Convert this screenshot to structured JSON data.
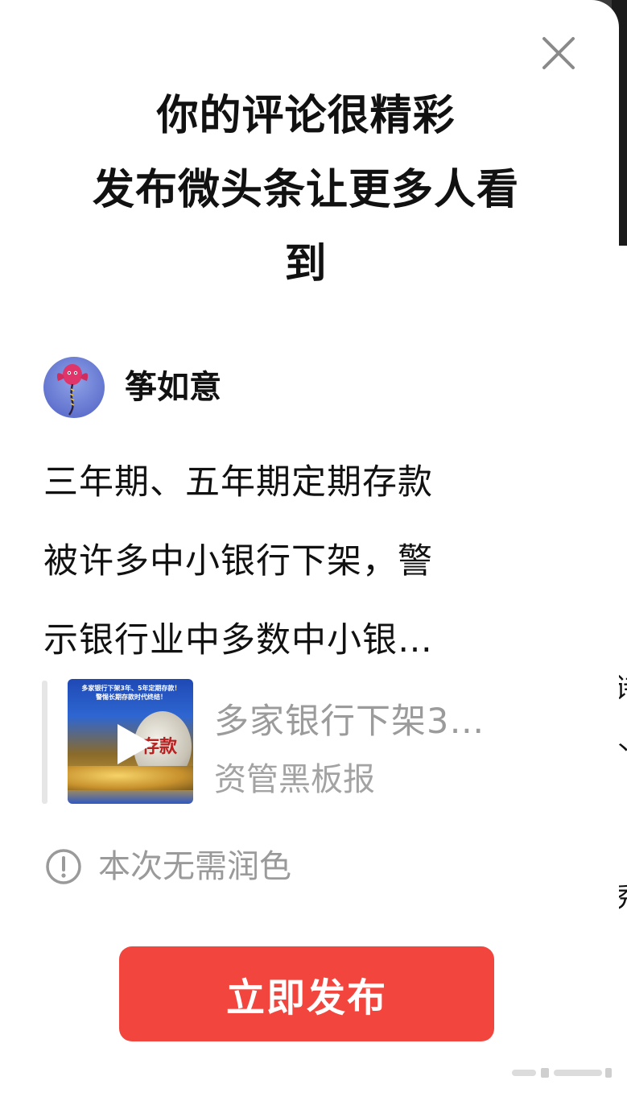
{
  "modal": {
    "title_lines": [
      "你的评论很精彩",
      "发布微头条让更多人看",
      "到"
    ]
  },
  "author": {
    "name": "筝如意",
    "avatar_icon": "kite-avatar-icon"
  },
  "comment": {
    "lines": [
      "三年期、五年期定期存款",
      "被许多中小银行下架，警",
      "示银行业中多数中小银…"
    ]
  },
  "article": {
    "title": "多家银行下架3…",
    "source": "资管黑板报",
    "thumbnail_caption": "多家银行下架3年、5年定期存款！\n警惕长期存款时代终结！",
    "thumbnail_coin_text": "存款"
  },
  "notice": {
    "text": "本次无需润色"
  },
  "actions": {
    "publish_label": "立即发布"
  },
  "background_glyphs": [
    "诗",
    "丫",
    "秀"
  ],
  "colors": {
    "primary_red": "#f2453d",
    "muted_gray": "#9b9b9b",
    "text_dark": "#111111"
  }
}
